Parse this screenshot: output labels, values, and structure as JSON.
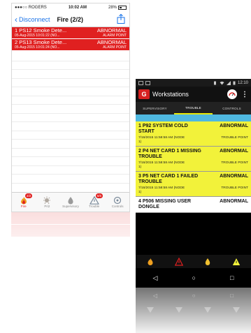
{
  "iphone": {
    "status": {
      "carrier": "●●●○○ ROGERS",
      "time": "10:02 AM",
      "battery": "28%"
    },
    "nav": {
      "back_label": "Disconnect",
      "title": "Fire (2/2)"
    },
    "alarms": [
      {
        "name": "1 PS12 Smoke Dete...",
        "status": "ABNORMAL",
        "timestamp": "05-Aug-2015 10:01:22 (NO...",
        "type": "ALARM POINT"
      },
      {
        "name": "2 PS13 Smoke Dete...",
        "status": "ABNORMAL",
        "timestamp": "05-Aug-2015 10:01:24 (NO...",
        "type": "ALARM POINT"
      }
    ],
    "tabs": [
      {
        "label": "Fire",
        "badge": "2/2"
      },
      {
        "label": "Pri2",
        "badge": ""
      },
      {
        "label": "Supervisory",
        "badge": ""
      },
      {
        "label": "Trouble",
        "badge": "5/6"
      },
      {
        "label": "Controls",
        "badge": ""
      }
    ]
  },
  "android": {
    "status": {
      "time": "12:10"
    },
    "appbar": {
      "logo": "G",
      "title": "Workstations"
    },
    "tabs": [
      {
        "label": "SUPERVISORY",
        "active": false
      },
      {
        "label": "TROUBLE",
        "active": true
      },
      {
        "label": "CONTROLS",
        "active": false
      }
    ],
    "rows": [
      {
        "name": "1 P92 SYSTEM COLD START",
        "status": "ABNORMAL",
        "timestamp": "7/16/2015 11:58:58 AM (NODE 1)",
        "type": "TROUBLE POINT",
        "color": "yellow"
      },
      {
        "name": "2 P4 NET CARD 1 MISSING TROUBLE",
        "status": "ABNORMAL",
        "timestamp": "7/16/2015 11:58:58 AM (NODE 1)",
        "type": "TROUBLE POINT",
        "color": "yellow"
      },
      {
        "name": "3 P5 NET CARD 1 FAILED TROUBLE",
        "status": "ABNORMAL",
        "timestamp": "7/16/2015 11:58:58 AM (NODE 1)",
        "type": "TROUBLE POINT",
        "color": "yellow"
      },
      {
        "name": "4 P506 MISSING USER DONGLE",
        "status": "ABNORMAL",
        "timestamp": "",
        "type": "",
        "color": "white"
      }
    ],
    "nav": {
      "back": "◁",
      "home": "○",
      "recent": "□"
    }
  },
  "colors": {
    "alarm_red": "#e02020",
    "trouble_yellow": "#f2f23a",
    "ios_blue": "#1a73e8",
    "strip_blue": "#4fb8e0"
  }
}
